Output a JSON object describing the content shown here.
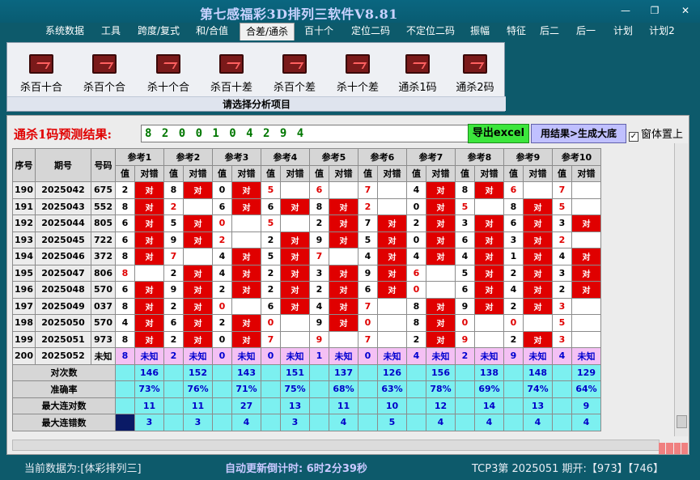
{
  "window": {
    "title": "第七感福彩3D排列三软件V8.81"
  },
  "menu": [
    "系统数据",
    "工具",
    "跨度/复式",
    "和/合值",
    "合差/通杀",
    "百十个",
    "定位二码",
    "不定位二码",
    "振幅",
    "特征",
    "后二",
    "后一",
    "计划",
    "计划2"
  ],
  "menu_active": 4,
  "toolbar": {
    "tools": [
      "杀百十合",
      "杀百个合",
      "杀十个合",
      "杀百十差",
      "杀百个差",
      "杀十个差",
      "通杀1码",
      "通杀2码"
    ],
    "caption": "请选择分析项目",
    "tool_icon": "chart-icon"
  },
  "prediction": {
    "label": "通杀1码预测结果:",
    "value": "8 2 0 0 1 0 4 2 9 4",
    "export_label": "导出excel",
    "generate_label": "用结果>生成大底",
    "ontop_label": "窗体置上",
    "ontop_checked": true
  },
  "table": {
    "col_seq": "序号",
    "col_period": "期号",
    "col_num": "号码",
    "refs": [
      "参考1",
      "参考2",
      "参考3",
      "参考4",
      "参考5",
      "参考6",
      "参考7",
      "参考8",
      "参考9",
      "参考10"
    ],
    "sub_val": "值",
    "sub_ok": "对错",
    "ok_mark": "对",
    "rows": [
      {
        "seq": "190",
        "period": "2025042",
        "num": "675",
        "vals": [
          "2",
          "8",
          "0",
          "5",
          "6",
          "7",
          "4",
          "8",
          "6",
          "7"
        ],
        "ok": [
          1,
          1,
          1,
          0,
          0,
          0,
          1,
          1,
          0,
          0
        ],
        "red": [
          0,
          0,
          0,
          1,
          1,
          1,
          0,
          0,
          1,
          1
        ]
      },
      {
        "seq": "191",
        "period": "2025043",
        "num": "552",
        "vals": [
          "8",
          "2",
          "6",
          "6",
          "8",
          "2",
          "0",
          "5",
          "8",
          "5"
        ],
        "ok": [
          1,
          0,
          1,
          1,
          1,
          0,
          1,
          0,
          1,
          0
        ],
        "red": [
          0,
          1,
          0,
          0,
          0,
          1,
          0,
          1,
          0,
          1
        ]
      },
      {
        "seq": "192",
        "period": "2025044",
        "num": "805",
        "vals": [
          "6",
          "5",
          "0",
          "5",
          "2",
          "7",
          "2",
          "3",
          "6",
          "3"
        ],
        "ok": [
          1,
          1,
          0,
          0,
          1,
          1,
          1,
          1,
          1,
          1
        ],
        "red": [
          0,
          0,
          1,
          1,
          0,
          0,
          0,
          0,
          0,
          0
        ]
      },
      {
        "seq": "193",
        "period": "2025045",
        "num": "722",
        "vals": [
          "6",
          "9",
          "2",
          "2",
          "9",
          "5",
          "0",
          "6",
          "3",
          "2"
        ],
        "ok": [
          1,
          1,
          0,
          1,
          1,
          1,
          1,
          1,
          1,
          0
        ],
        "red": [
          0,
          0,
          1,
          0,
          0,
          0,
          0,
          0,
          0,
          1
        ]
      },
      {
        "seq": "194",
        "period": "2025046",
        "num": "372",
        "vals": [
          "8",
          "7",
          "4",
          "5",
          "7",
          "4",
          "4",
          "4",
          "1",
          "4"
        ],
        "ok": [
          1,
          0,
          1,
          1,
          0,
          1,
          1,
          1,
          1,
          1
        ],
        "red": [
          0,
          1,
          0,
          0,
          1,
          0,
          0,
          0,
          0,
          0
        ]
      },
      {
        "seq": "195",
        "period": "2025047",
        "num": "806",
        "vals": [
          "8",
          "2",
          "4",
          "2",
          "3",
          "9",
          "6",
          "5",
          "2",
          "3"
        ],
        "ok": [
          0,
          1,
          1,
          1,
          1,
          1,
          0,
          1,
          1,
          1
        ],
        "red": [
          1,
          0,
          0,
          0,
          0,
          0,
          1,
          0,
          0,
          0
        ]
      },
      {
        "seq": "196",
        "period": "2025048",
        "num": "570",
        "vals": [
          "6",
          "9",
          "2",
          "2",
          "2",
          "6",
          "0",
          "6",
          "4",
          "2"
        ],
        "ok": [
          1,
          1,
          1,
          1,
          1,
          1,
          0,
          1,
          1,
          1
        ],
        "red": [
          0,
          0,
          0,
          0,
          0,
          0,
          1,
          0,
          0,
          0
        ]
      },
      {
        "seq": "197",
        "period": "2025049",
        "num": "037",
        "vals": [
          "8",
          "2",
          "0",
          "6",
          "4",
          "7",
          "8",
          "9",
          "2",
          "3"
        ],
        "ok": [
          1,
          1,
          0,
          1,
          1,
          0,
          1,
          1,
          1,
          0
        ],
        "red": [
          0,
          0,
          1,
          0,
          0,
          1,
          0,
          0,
          0,
          1
        ]
      },
      {
        "seq": "198",
        "period": "2025050",
        "num": "570",
        "vals": [
          "4",
          "6",
          "2",
          "0",
          "9",
          "0",
          "8",
          "0",
          "0",
          "5"
        ],
        "ok": [
          1,
          1,
          1,
          0,
          1,
          0,
          1,
          0,
          0,
          0
        ],
        "red": [
          0,
          0,
          0,
          1,
          0,
          1,
          0,
          1,
          1,
          1
        ]
      },
      {
        "seq": "199",
        "period": "2025051",
        "num": "973",
        "vals": [
          "8",
          "2",
          "0",
          "7",
          "9",
          "7",
          "2",
          "9",
          "2",
          "3"
        ],
        "ok": [
          1,
          1,
          1,
          0,
          0,
          0,
          1,
          0,
          1,
          0
        ],
        "red": [
          0,
          0,
          0,
          1,
          1,
          1,
          0,
          1,
          0,
          1
        ]
      }
    ],
    "current_row": {
      "seq": "200",
      "period": "2025052",
      "num": "未知",
      "vals": [
        "8",
        "2",
        "0",
        "0",
        "1",
        "0",
        "4",
        "2",
        "9",
        "4"
      ],
      "unknown": "未知"
    },
    "stats": [
      {
        "label": "对次数",
        "values": [
          "146",
          "152",
          "143",
          "151",
          "137",
          "126",
          "156",
          "138",
          "148",
          "129"
        ]
      },
      {
        "label": "准确率",
        "values": [
          "73%",
          "76%",
          "71%",
          "75%",
          "68%",
          "63%",
          "78%",
          "69%",
          "74%",
          "64%"
        ]
      },
      {
        "label": "最大连对数",
        "values": [
          "11",
          "11",
          "27",
          "13",
          "11",
          "10",
          "12",
          "14",
          "13",
          "9"
        ]
      },
      {
        "label": "最大连错数",
        "values": [
          "3",
          "3",
          "4",
          "3",
          "4",
          "5",
          "4",
          "4",
          "4",
          "4"
        ]
      }
    ]
  },
  "status": {
    "data_source": "当前数据为:[体彩排列三]",
    "countdown": "自动更新倒计时: 6时2分39秒",
    "issue": "TCP3第 2025051 期开:【973】【746】"
  }
}
